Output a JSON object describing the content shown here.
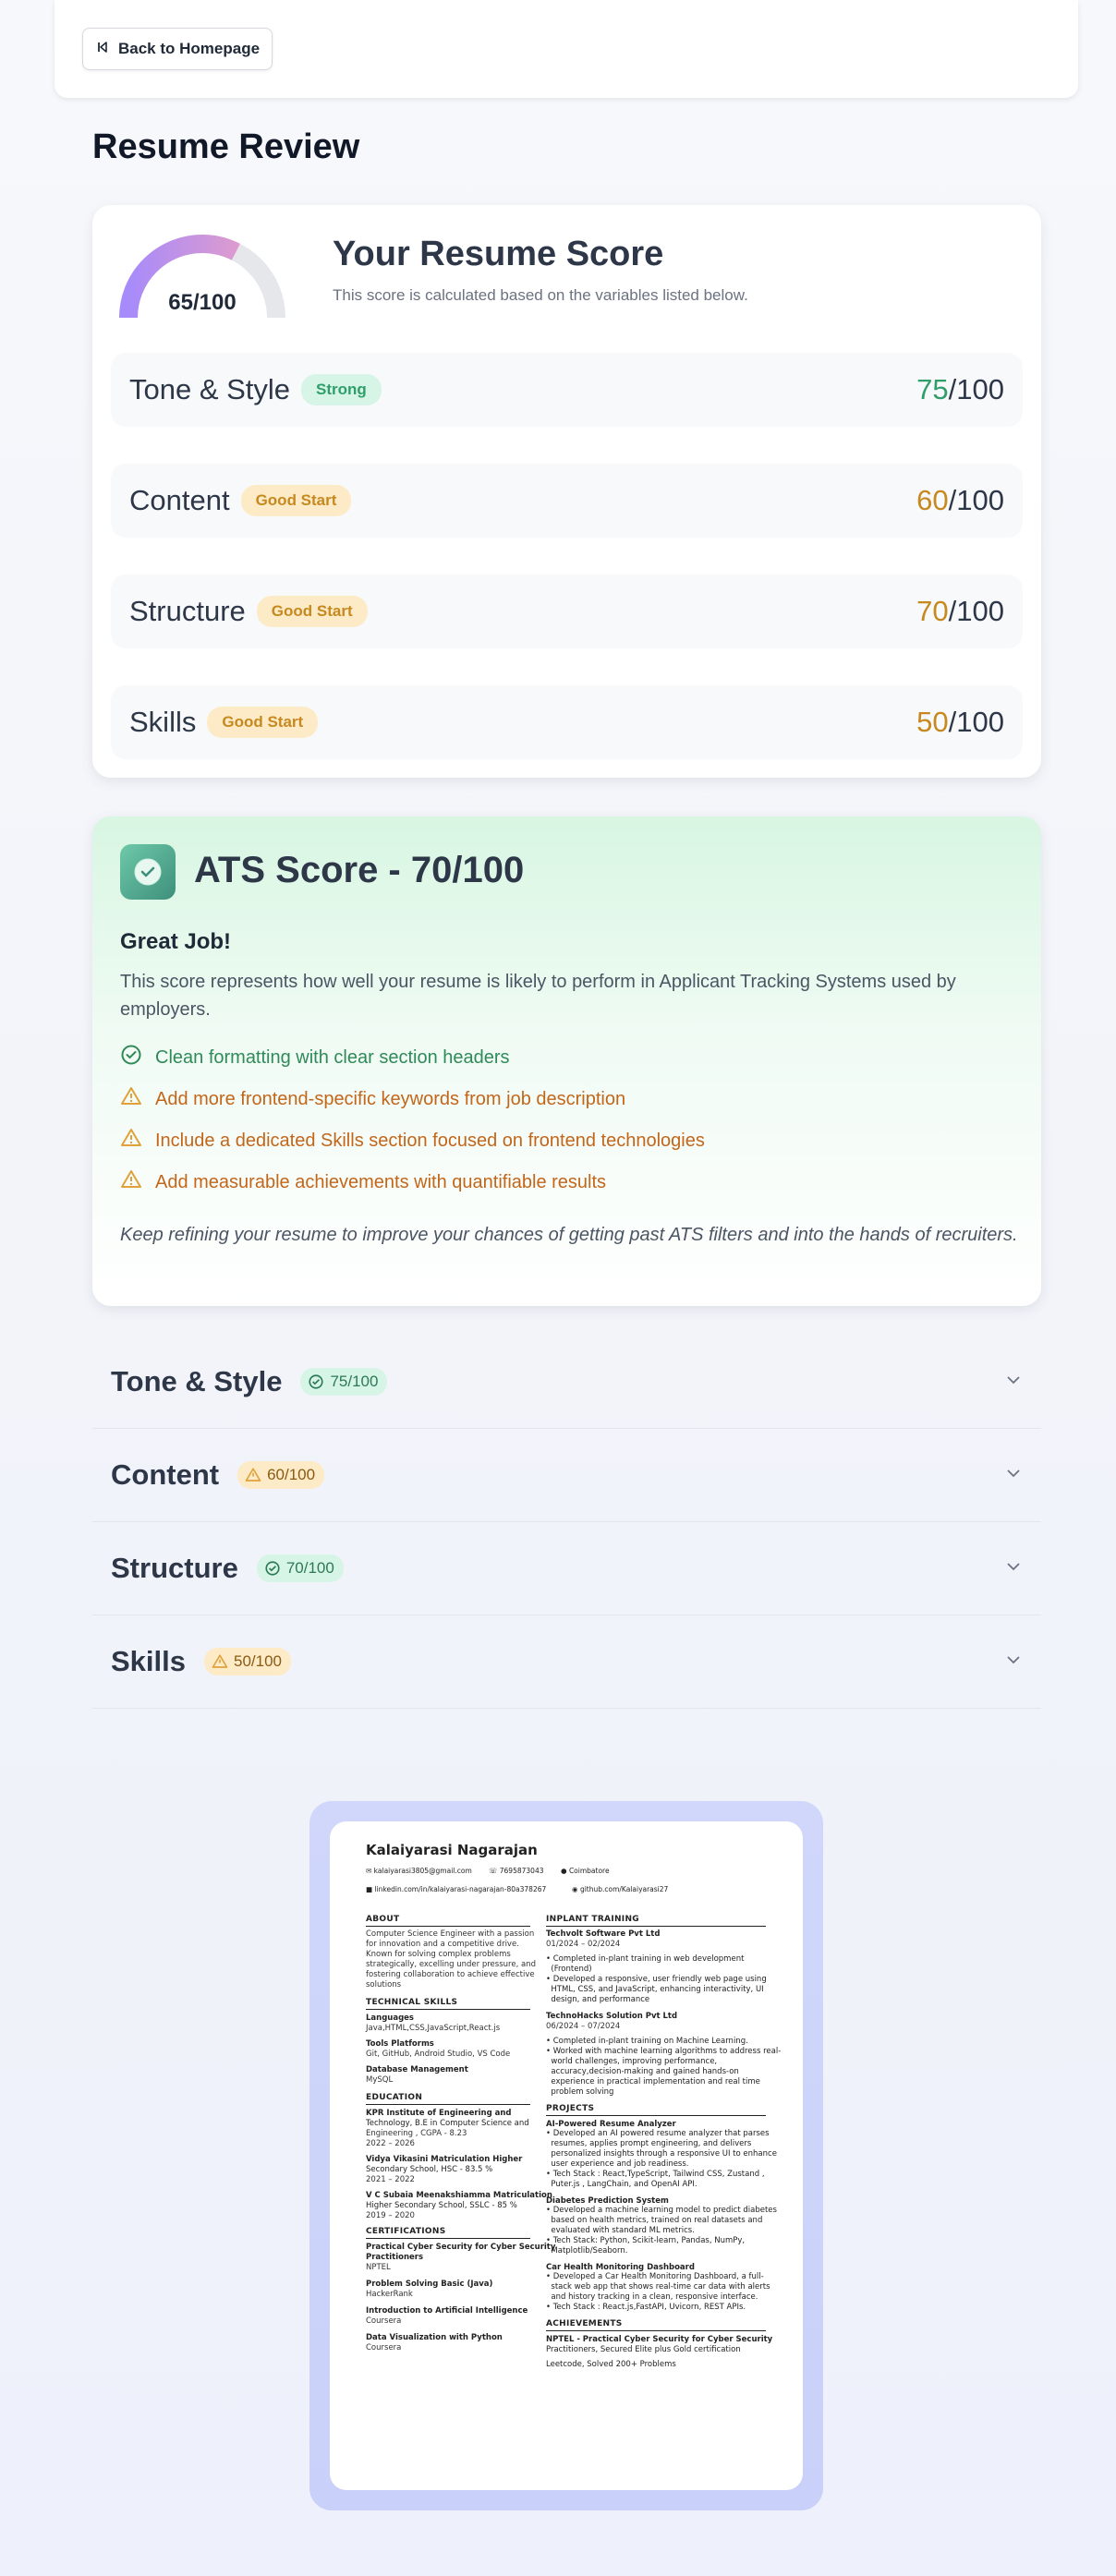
{
  "nav": {
    "back_label": "Back to Homepage"
  },
  "page_title": "Resume Review",
  "score_card": {
    "overall": "65/100",
    "overall_value": 65,
    "title": "Your Resume Score",
    "subtitle": "This score is calculated based on the variables listed below.",
    "categories": [
      {
        "name": "Tone & Style",
        "badge": "Strong",
        "score": "75",
        "max": "/100",
        "tone": "green"
      },
      {
        "name": "Content",
        "badge": "Good Start",
        "score": "60",
        "max": "/100",
        "tone": "amber"
      },
      {
        "name": "Structure",
        "badge": "Good Start",
        "score": "70",
        "max": "/100",
        "tone": "amber"
      },
      {
        "name": "Skills",
        "badge": "Good Start",
        "score": "50",
        "max": "/100",
        "tone": "amber"
      }
    ]
  },
  "ats": {
    "title": "ATS Score - 70/100",
    "subtitle": "Great Job!",
    "description": "This score represents how well your resume is likely to perform in Applicant Tracking Systems used by employers.",
    "tips": [
      {
        "text": "Clean formatting with clear section headers",
        "type": "good"
      },
      {
        "text": "Add more frontend-specific keywords from job description",
        "type": "warn"
      },
      {
        "text": "Include a dedicated Skills section focused on frontend technologies",
        "type": "warn"
      },
      {
        "text": "Add measurable achievements with quantifiable results",
        "type": "warn"
      }
    ],
    "note": "Keep refining your resume to improve your chances of getting past ATS filters and into the hands of recruiters."
  },
  "accordion": [
    {
      "title": "Tone & Style",
      "score": "75/100",
      "tone": "green"
    },
    {
      "title": "Content",
      "score": "60/100",
      "tone": "amber"
    },
    {
      "title": "Structure",
      "score": "70/100",
      "tone": "green"
    },
    {
      "title": "Skills",
      "score": "50/100",
      "tone": "amber"
    }
  ],
  "colors": {
    "green": "#2f9e6a",
    "amber": "#c7891f",
    "ats_bg": "#d8f6e2",
    "resume_frame": "#cdd5fb"
  },
  "resume": {
    "name": "Kalaiyarasi Nagarajan",
    "email": "kalaiyarasi3805@gmail.com",
    "phone": "7695873043",
    "location": "Coimbatore",
    "linkedin": "linkedin.com/in/kalaiyarasi-nagarajan-80a378267",
    "github": "github.com/Kalaiyarasi27",
    "about_h": "ABOUT",
    "about": [
      "Computer Science Engineer with a passion",
      "for innovation and a competitive drive.",
      "Known for solving complex problems",
      "strategically, excelling under pressure, and",
      "fostering collaboration to achieve effective",
      "solutions"
    ],
    "skills_h": "TECHNICAL SKILLS",
    "skills": [
      {
        "h": "Languages",
        "v": "Java,HTML,CSS,JavaScript,React.js"
      },
      {
        "h": "Tools Platforms",
        "v": "Git, GitHub, Android Studio, VS Code"
      },
      {
        "h": "Database Management",
        "v": "MySQL"
      }
    ],
    "edu_h": "EDUCATION",
    "edu": [
      {
        "l1": "KPR Institute of Engineering and",
        "l2": "Technology, B.E in Computer Science and",
        "l3": "Engineering , CGPA - 8.23",
        "l4": "2022 – 2026"
      },
      {
        "l1": "Vidya Vikasini Matriculation Higher",
        "l2": "Secondary School, HSC - 83.5 %",
        "l3": "2021 – 2022"
      },
      {
        "l1": "V C Subaia Meenakshiamma Matriculation",
        "l2": "Higher Secondary School, SSLC - 85 %",
        "l3": "2019 – 2020"
      }
    ],
    "cert_h": "CERTIFICATIONS",
    "certs": [
      {
        "l1": "Practical Cyber Security for Cyber Security",
        "l2": "Practitioners",
        "p": "NPTEL"
      },
      {
        "l1": "Problem Solving Basic (Java)",
        "p": "HackerRank"
      },
      {
        "l1": "Introduction to Artificial Intelligence",
        "p": "Coursera"
      },
      {
        "l1": "Data Visualization with Python",
        "p": "Coursera"
      }
    ],
    "train_h": "INPLANT TRAINING",
    "train": [
      {
        "c": "Techvolt Software Pvt Ltd",
        "d": "01/2024 – 02/2024",
        "b": [
          "• Completed in-plant training in web development",
          "  (Frontend)",
          "• Developed a responsive, user friendly web page using",
          "  HTML, CSS, and JavaScript, enhancing interactivity, UI",
          "  design, and performance"
        ]
      },
      {
        "c": "TechnoHacks Solution Pvt Ltd",
        "d": "06/2024 – 07/2024",
        "b": [
          "• Completed in-plant training on Machine Learning.",
          "• Worked with machine learning algorithms to address real-",
          "  world challenges, improving performance,",
          "  accuracy,decision-making and gained hands-on",
          "  experience in practical implementation and real time",
          "  problem solving"
        ]
      }
    ],
    "proj_h": "PROJECTS",
    "proj": [
      {
        "t": "AI-Powered Resume Analyzer",
        "b": [
          "• Developed an AI powered resume analyzer that parses",
          "  resumes, applies prompt engineering, and delivers",
          "  personalized insights through a responsive UI to enhance",
          "  user experience and job readiness.",
          "• Tech Stack : React,TypeScript, Tailwind CSS, Zustand ,",
          "  Puter.js , LangChain, and OpenAI API."
        ]
      },
      {
        "t": "Diabetes Prediction System",
        "b": [
          "• Developed a machine learning model to predict diabetes",
          "  based on health metrics, trained on real datasets and",
          "  evaluated with standard ML metrics.",
          "• Tech Stack: Python, Scikit-learn, Pandas, NumPy,",
          "  Matplotlib/Seaborn."
        ]
      },
      {
        "t": "Car Health Monitoring Dashboard",
        "b": [
          "• Developed a Car Health Monitoring Dashboard, a full-",
          "  stack web app that shows real-time car data with alerts",
          "  and history tracking in a clean, responsive interface.",
          "• Tech Stack : React.js,FastAPI, Uvicorn, REST APIs."
        ]
      }
    ],
    "ach_h": "ACHIEVEMENTS",
    "ach": [
      "NPTEL - Practical Cyber Security for Cyber Security",
      "Practitioners, Secured Elite plus Gold certification",
      "Leetcode, Solved 200+ Problems"
    ]
  }
}
